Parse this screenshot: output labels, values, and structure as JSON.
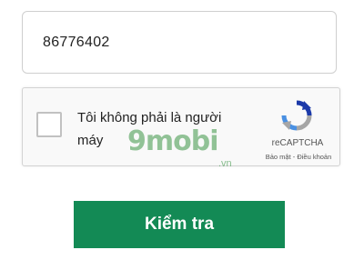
{
  "phone_input": {
    "value": "86776402"
  },
  "captcha": {
    "label": "Tôi không phải là người máy",
    "brand": "reCAPTCHA",
    "links": "Bảo mật - Điều khoản",
    "checked": false
  },
  "watermark": {
    "brand": "9mobi",
    "domain": ".vn"
  },
  "submit": {
    "label": "Kiểm tra"
  },
  "colors": {
    "button": "#138a55",
    "recaptcha_blue": "#1c3aa9",
    "recaptcha_gray": "#a6a6a6"
  }
}
